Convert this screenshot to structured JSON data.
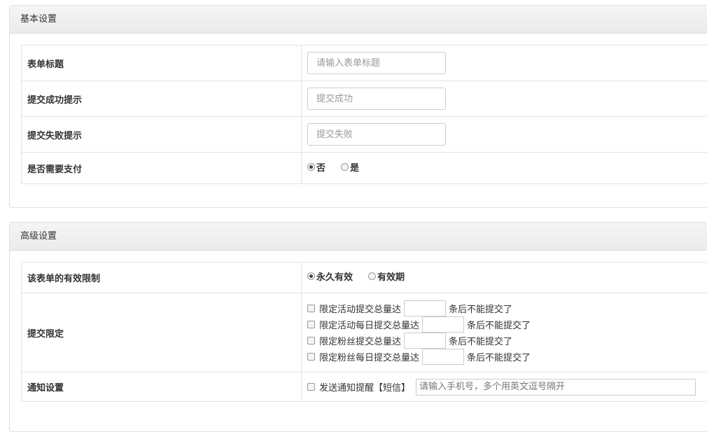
{
  "basic": {
    "title": "基本设置",
    "rows": [
      {
        "label": "表单标题",
        "placeholder": "请输入表单标题"
      },
      {
        "label": "提交成功提示",
        "placeholder": "提交成功"
      },
      {
        "label": "提交失败提示",
        "placeholder": "提交失败"
      }
    ],
    "payment": {
      "label": "是否需要支付",
      "options": [
        "否",
        "是"
      ],
      "selected": "否"
    }
  },
  "advanced": {
    "title": "高级设置",
    "validity": {
      "label": "该表单的有效限制",
      "options": [
        "永久有效",
        "有效期"
      ],
      "selected": "永久有效"
    },
    "limits": {
      "label": "提交限定",
      "items": [
        {
          "text": "限定活动提交总量达",
          "suffix": "条后不能提交了"
        },
        {
          "text": "限定活动每日提交总量达",
          "suffix": "条后不能提交了"
        },
        {
          "text": "限定粉丝提交总量达",
          "suffix": "条后不能提交了"
        },
        {
          "text": "限定粉丝每日提交总量达",
          "suffix": "条后不能提交了"
        }
      ]
    },
    "notify": {
      "label": "通知设置",
      "checkbox_text": "发送通知提醒【短信】",
      "placeholder": "请输入手机号，多个用英文逗号隔开"
    }
  }
}
